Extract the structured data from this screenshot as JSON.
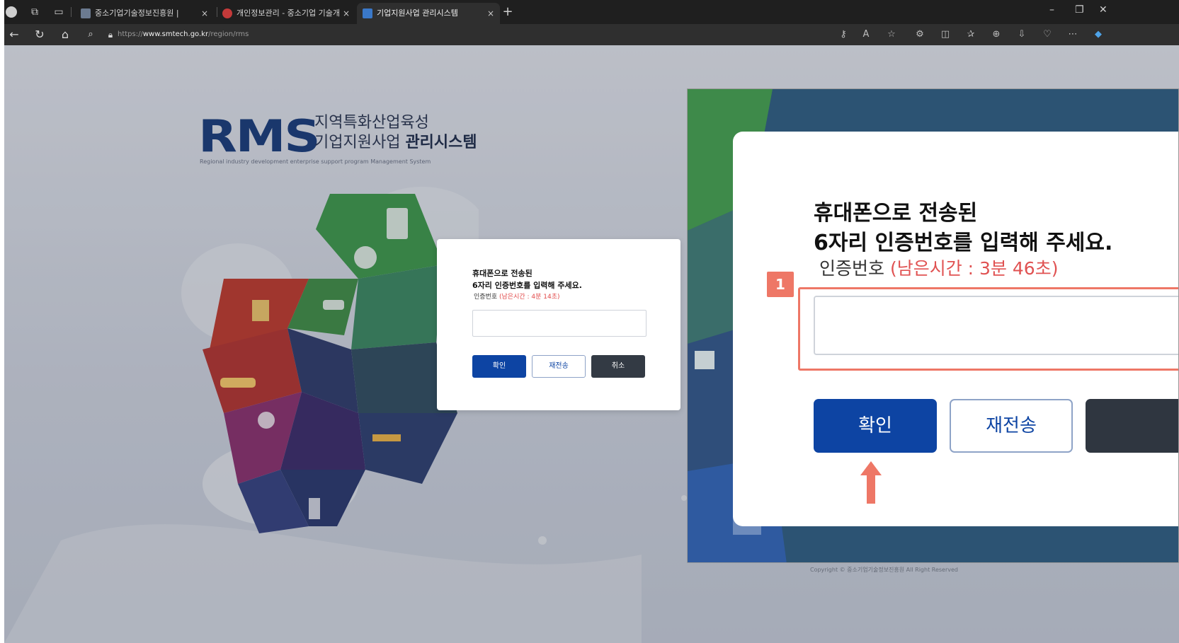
{
  "browser": {
    "tabs": [
      {
        "title": "중소기업기술정보진흥원 |",
        "close": "×"
      },
      {
        "title": "개인정보관리 - 중소기업 기술개",
        "close": "×"
      },
      {
        "title": "기업지원사업 관리시스템",
        "close": "×"
      }
    ],
    "new_tab": "+",
    "url_scheme": "https://",
    "url_host": "www.smtech.go.kr",
    "url_path": "/region/rms",
    "window_controls": {
      "minimize": "–",
      "maximize": "❐",
      "close": "✕"
    }
  },
  "page": {
    "logo_text": "RMS",
    "title_line1": "지역특화산업육성",
    "title_line2_plain": "기업지원사업 ",
    "title_line2_bold": "관리시스템",
    "subtitle": "Regional industry development enterprise support program Management System",
    "copyright": "Copyright © 중소기업기술정보진흥원 All Right Reserved"
  },
  "small_dialog": {
    "line1": "휴대폰으로 전송된",
    "line2": "6자리 인증번호를 입력해 주세요.",
    "label": "인증번호",
    "remaining": "(남은시간 : 4분 14초)",
    "input_value": "",
    "confirm": "확인",
    "resend": "재전송",
    "cancel": "취소"
  },
  "zoom_dialog": {
    "line1": "휴대폰으로 전송된",
    "line2": "6자리 인증번호를 입력해 주세요.",
    "label": "인증번호",
    "remaining": "(남은시간 : 3분 46초)",
    "input_value": "",
    "confirm": "확인",
    "resend": "재전송",
    "marker": "1"
  },
  "colors": {
    "primary": "#0d44a3",
    "dark_button": "#333a44",
    "remaining_text": "#e24a4a",
    "annotation": "#ee7766"
  }
}
